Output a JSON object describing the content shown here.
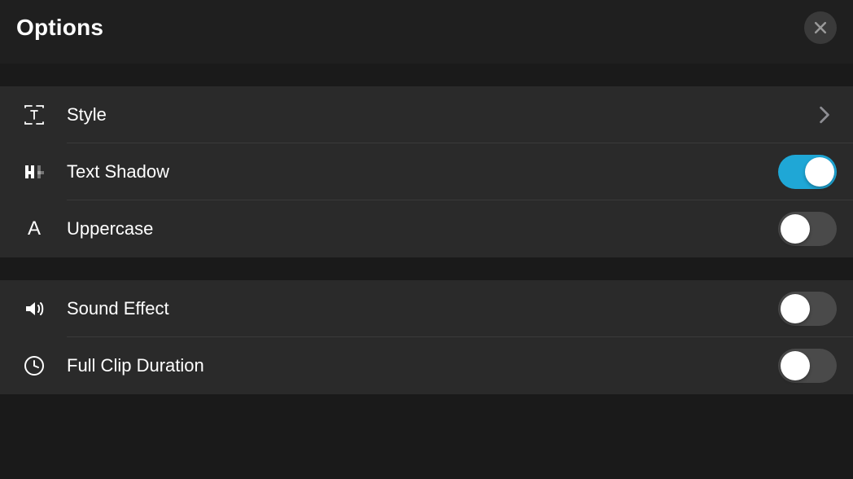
{
  "header": {
    "title": "Options"
  },
  "section1": {
    "style": {
      "label": "Style"
    },
    "textShadow": {
      "label": "Text Shadow",
      "on": true
    },
    "uppercase": {
      "label": "Uppercase",
      "on": false
    }
  },
  "section2": {
    "soundEffect": {
      "label": "Sound Effect",
      "on": false
    },
    "fullClipDuration": {
      "label": "Full Clip Duration",
      "on": false
    }
  },
  "colors": {
    "toggleOn": "#1fa7d6",
    "toggleOff": "#4a4a4a",
    "background": "#1a1a1a",
    "rowBackground": "#2a2a2a"
  }
}
